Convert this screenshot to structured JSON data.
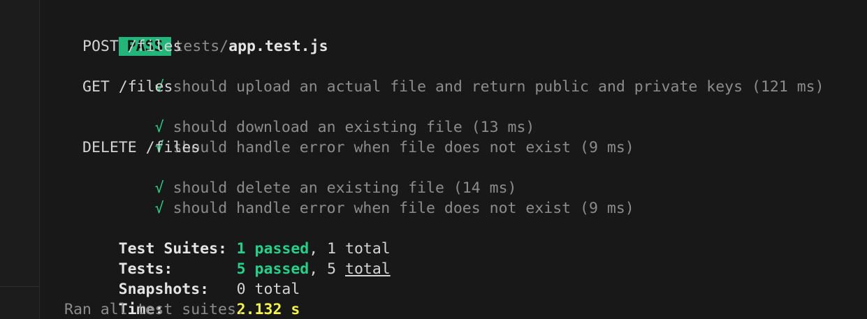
{
  "header": {
    "badge": "PASS",
    "path_dir": "tests/",
    "path_file": "app.test.js"
  },
  "groups": [
    {
      "title": "POST /files",
      "tests": [
        {
          "mark": "√",
          "text": "should upload an actual file and return public and private keys (121 ms)"
        }
      ]
    },
    {
      "title": "GET /files",
      "tests": [
        {
          "mark": "√",
          "text": "should download an existing file (13 ms)"
        },
        {
          "mark": "√",
          "text": "should handle error when file does not exist (9 ms)"
        }
      ]
    },
    {
      "title": "DELETE /files",
      "tests": [
        {
          "mark": "√",
          "text": "should delete an existing file (14 ms)"
        },
        {
          "mark": "√",
          "text": "should handle error when file does not exist (9 ms)"
        }
      ]
    }
  ],
  "summary": {
    "suites": {
      "label": "Test Suites:",
      "passed": "1 passed",
      "sep": ", ",
      "total": "1 total"
    },
    "tests": {
      "label": "Tests:",
      "passed": "5 passed",
      "sep": ", ",
      "total_num": "5 ",
      "total_word": "total"
    },
    "snapshots": {
      "label": "Snapshots:",
      "value": "0 total"
    },
    "time": {
      "label": "Time:",
      "value": "2.132 s"
    },
    "footer": "Ran all test suites."
  },
  "colors": {
    "background": "#181818",
    "pass_badge": "#23b67a",
    "check": "#23d18b",
    "time": "#f5f543"
  }
}
